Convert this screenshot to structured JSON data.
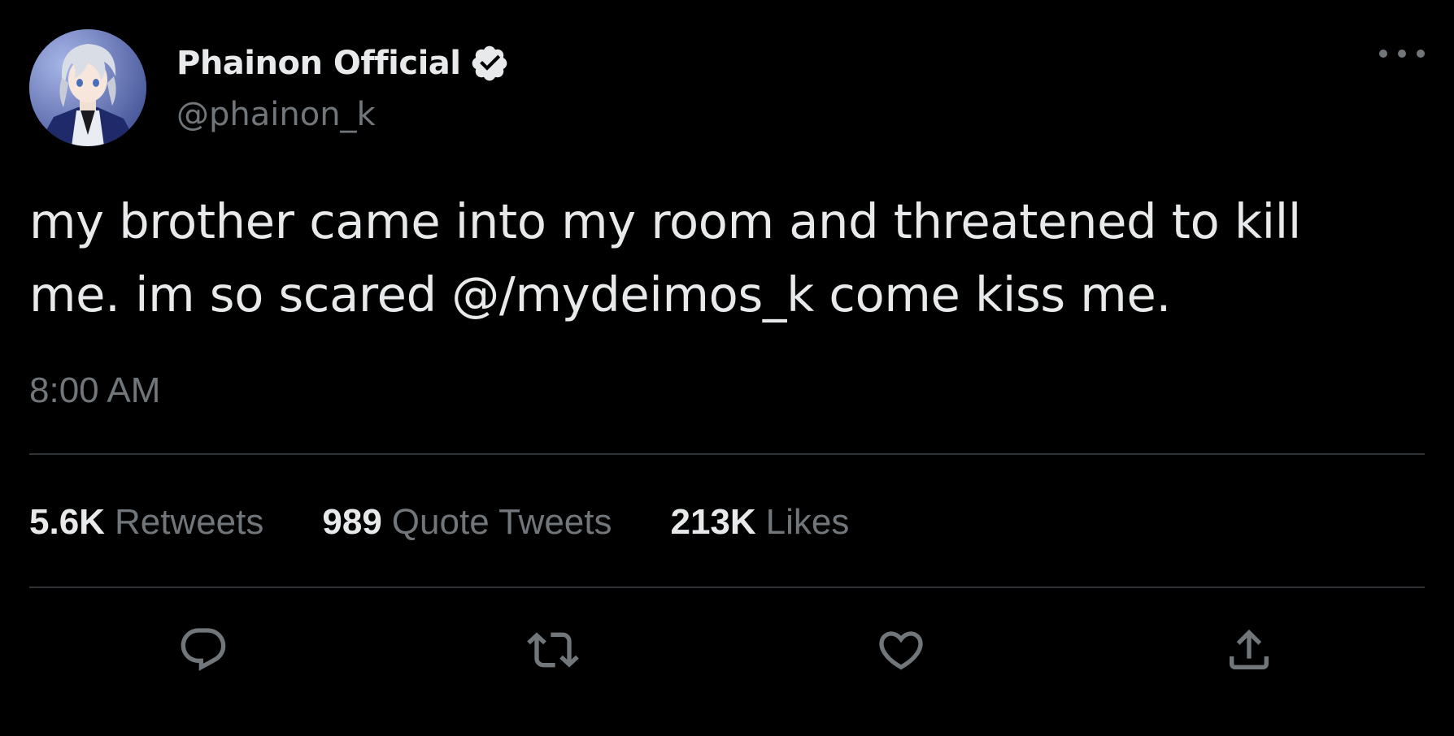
{
  "author": {
    "display_name": "Phainon Official",
    "handle": "@phainon_k",
    "verified": true,
    "avatar_icon": "anime-avatar"
  },
  "tweet": {
    "text_lines": [
      "my brother came into my room and threatened to kill",
      "me. im so scared @/mydeimos_k come kiss me."
    ],
    "time": "8:00 AM"
  },
  "stats": {
    "retweets_count": "5.6K",
    "retweets_label": "Retweets",
    "quotes_count": "989",
    "quotes_label": "Quote Tweets",
    "likes_count": "213K",
    "likes_label": "Likes"
  },
  "actions": {
    "reply_icon": "reply-icon",
    "retweet_icon": "retweet-icon",
    "like_icon": "heart-icon",
    "share_icon": "share-icon"
  },
  "colors": {
    "background": "#000000",
    "primary_text": "#e7e9ea",
    "secondary_text": "#71767b",
    "divider": "#2f3336"
  }
}
